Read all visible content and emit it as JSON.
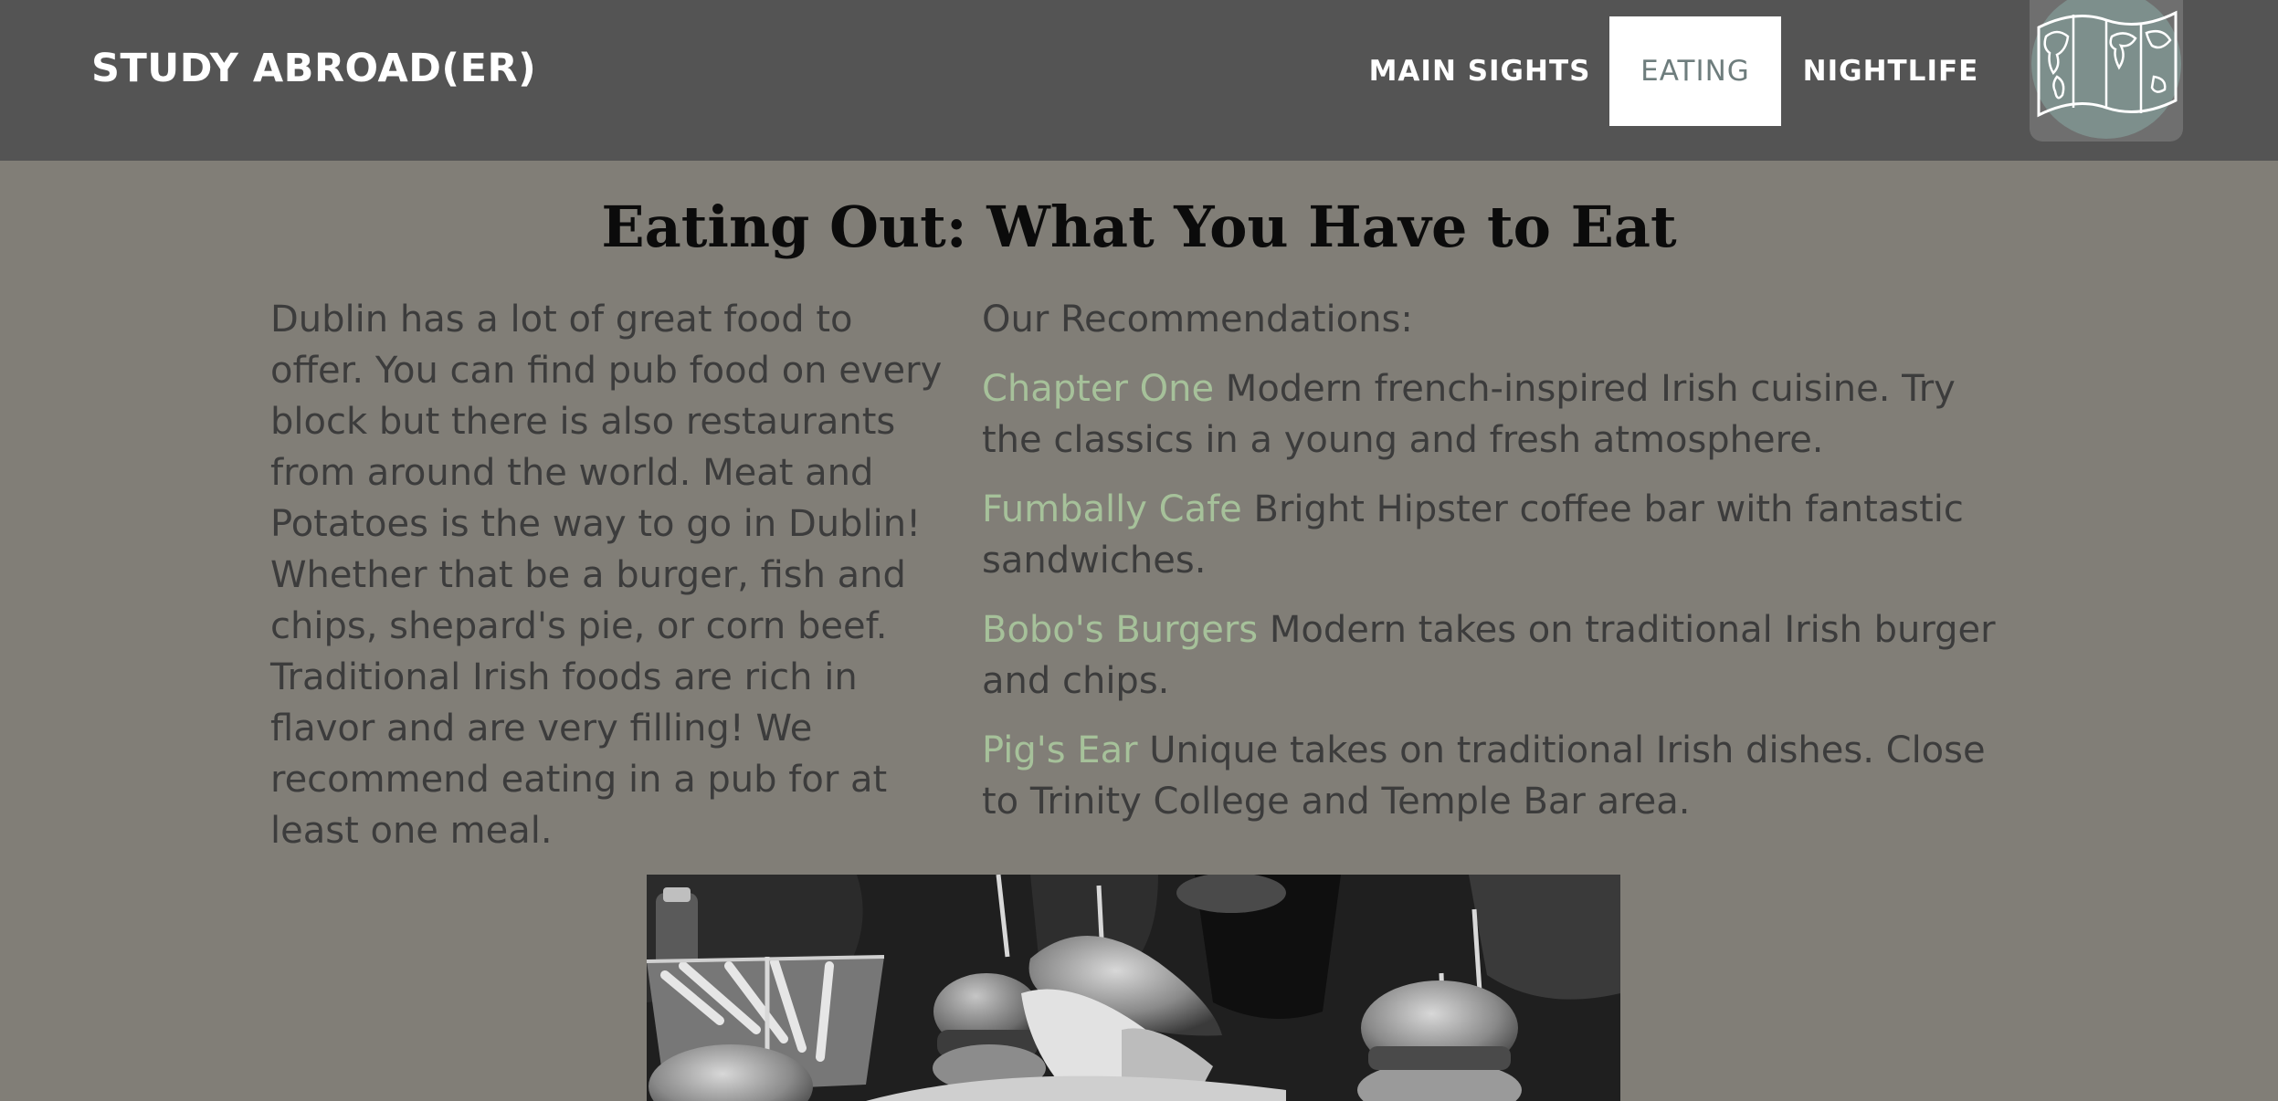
{
  "header": {
    "brand": "STUDY ABROAD(ER)",
    "nav": [
      {
        "label": "MAIN SIGHTS",
        "active": false
      },
      {
        "label": "EATING",
        "active": true
      },
      {
        "label": "NIGHTLIFE",
        "active": false
      }
    ],
    "logo_icon": "world-map-icon",
    "background": "#545454"
  },
  "main": {
    "title": "Eating Out: What You Have to Eat",
    "intro": "Dublin has a lot of great food to offer. You can find pub food on every block but there is also restaurants from around the world. Meat and Potatoes is the way to go in Dublin! Whether that be a burger, fish and chips, shepard's pie, or corn beef. Traditional Irish foods are rich in flavor and are very filling! We recommend eating in a pub for at least one meal.",
    "recommendations_heading": "Our Recommendations:",
    "recommendations": [
      {
        "name": "Chapter One",
        "description": " Modern french-inspired Irish cuisine. Try the classics in a young and fresh atmosphere."
      },
      {
        "name": "Fumbally Cafe",
        "description": " Bright Hipster coffee bar with fantastic sandwiches."
      },
      {
        "name": "Bobo's Burgers",
        "description": " Modern takes on traditional Irish burger and chips."
      },
      {
        "name": "Pig's Ear",
        "description": " Unique takes on traditional Irish dishes. Close to Trinity College and Temple Bar area."
      }
    ],
    "photo": "burgers-photo"
  },
  "colors": {
    "page_background": "#817e77",
    "link_green": "#a6c19a",
    "body_text": "#3c3c3c"
  }
}
